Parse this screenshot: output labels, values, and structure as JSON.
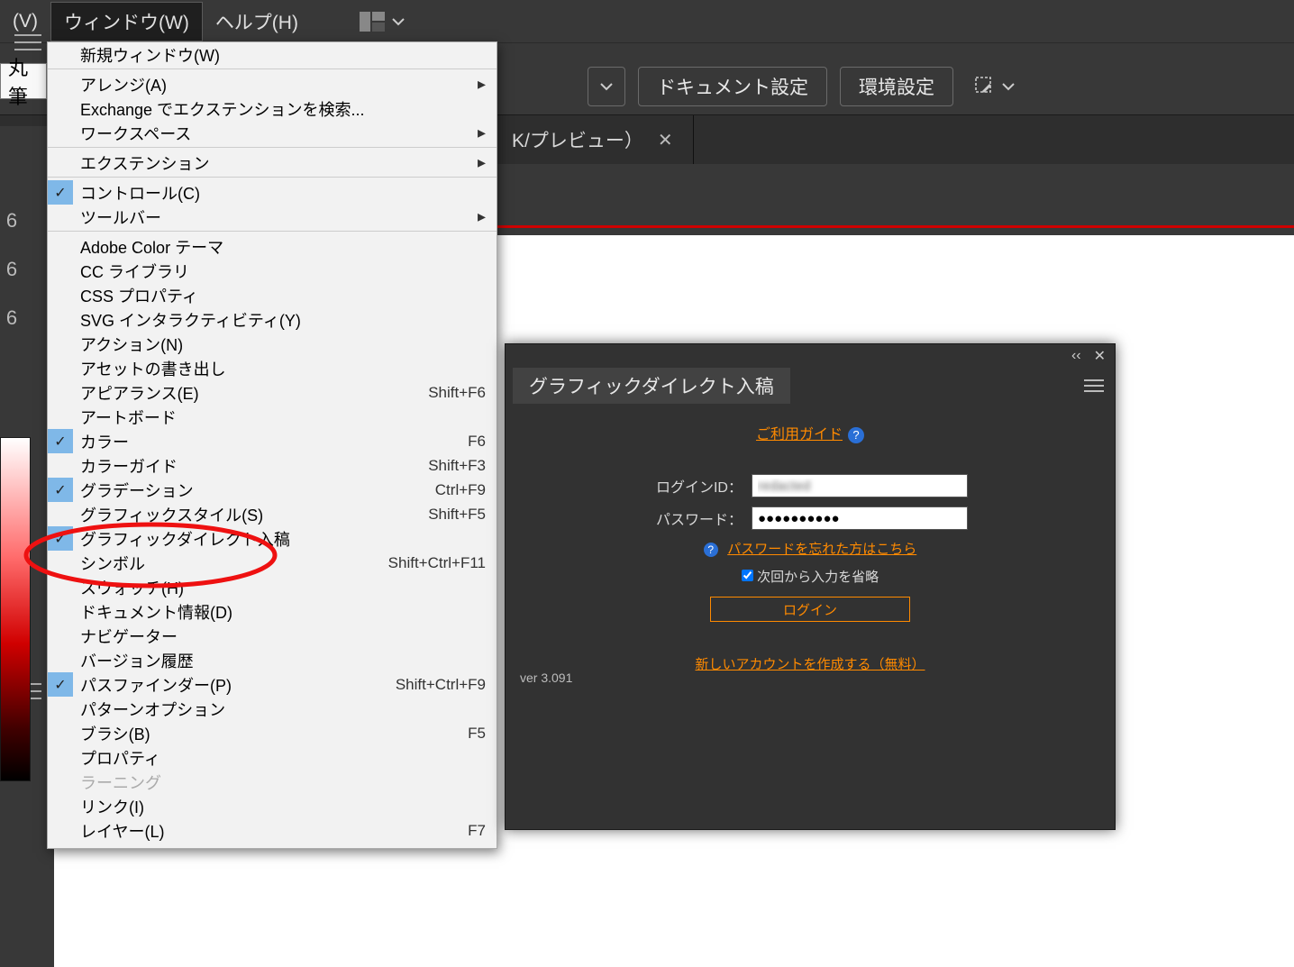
{
  "menubar": {
    "view": "(V)",
    "window": "ウィンドウ(W)",
    "help": "ヘルプ(H)"
  },
  "toolbar2": {
    "brush_field": "丸筆",
    "doc_settings": "ドキュメント設定",
    "env_settings": "環境設定"
  },
  "tabrow": {
    "tab_suffix": "K/プレビュー）"
  },
  "left": {
    "pct1": "6",
    "pct2": "6",
    "pct3": "6"
  },
  "dropdown": {
    "items": [
      {
        "label": "新規ウィンドウ(W)",
        "sep_after": true
      },
      {
        "label": "アレンジ(A)",
        "submenu": true
      },
      {
        "label": "Exchange でエクステンションを検索..."
      },
      {
        "label": "ワークスペース",
        "submenu": true,
        "sep_after": true
      },
      {
        "label": "エクステンション",
        "submenu": true,
        "sep_after": true
      },
      {
        "label": "コントロール(C)",
        "checked": true
      },
      {
        "label": "ツールバー",
        "submenu": true,
        "sep_after": true
      },
      {
        "label": "Adobe Color テーマ"
      },
      {
        "label": "CC ライブラリ"
      },
      {
        "label": "CSS プロパティ"
      },
      {
        "label": "SVG インタラクティビティ(Y)"
      },
      {
        "label": "アクション(N)"
      },
      {
        "label": "アセットの書き出し"
      },
      {
        "label": "アピアランス(E)",
        "shortcut": "Shift+F6"
      },
      {
        "label": "アートボード"
      },
      {
        "label": "カラー",
        "shortcut": "F6",
        "checked": true
      },
      {
        "label": "カラーガイド",
        "shortcut": "Shift+F3"
      },
      {
        "label": "グラデーション",
        "shortcut": "Ctrl+F9",
        "checked": true
      },
      {
        "label": "グラフィックスタイル(S)",
        "shortcut": "Shift+F5"
      },
      {
        "label": "グラフィックダイレクト入稿",
        "checked": true
      },
      {
        "label": "シンボル",
        "shortcut": "Shift+Ctrl+F11"
      },
      {
        "label": "スウォッチ(H)"
      },
      {
        "label": "ドキュメント情報(D)"
      },
      {
        "label": "ナビゲーター"
      },
      {
        "label": "バージョン履歴"
      },
      {
        "label": "パスファインダー(P)",
        "shortcut": "Shift+Ctrl+F9",
        "checked": true
      },
      {
        "label": "パターンオプション"
      },
      {
        "label": "ブラシ(B)",
        "shortcut": "F5"
      },
      {
        "label": "プロパティ"
      },
      {
        "label": "ラーニング",
        "disabled": true
      },
      {
        "label": "リンク(I)"
      },
      {
        "label": "レイヤー(L)",
        "shortcut": "F7"
      }
    ]
  },
  "panel": {
    "title": "グラフィックダイレクト入稿",
    "guide_label": "ご利用ガイド",
    "login_id_label": "ログインID：",
    "login_id_value": "redacted",
    "password_label": "パスワード：",
    "password_value": "●●●●●●●●●●",
    "forgot_label": "パスワードを忘れた方はこちら",
    "remember_label": "次回から入力を省略",
    "login_button": "ログイン",
    "create_account": "新しいアカウントを作成する（無料）",
    "version": "ver 3.091"
  }
}
